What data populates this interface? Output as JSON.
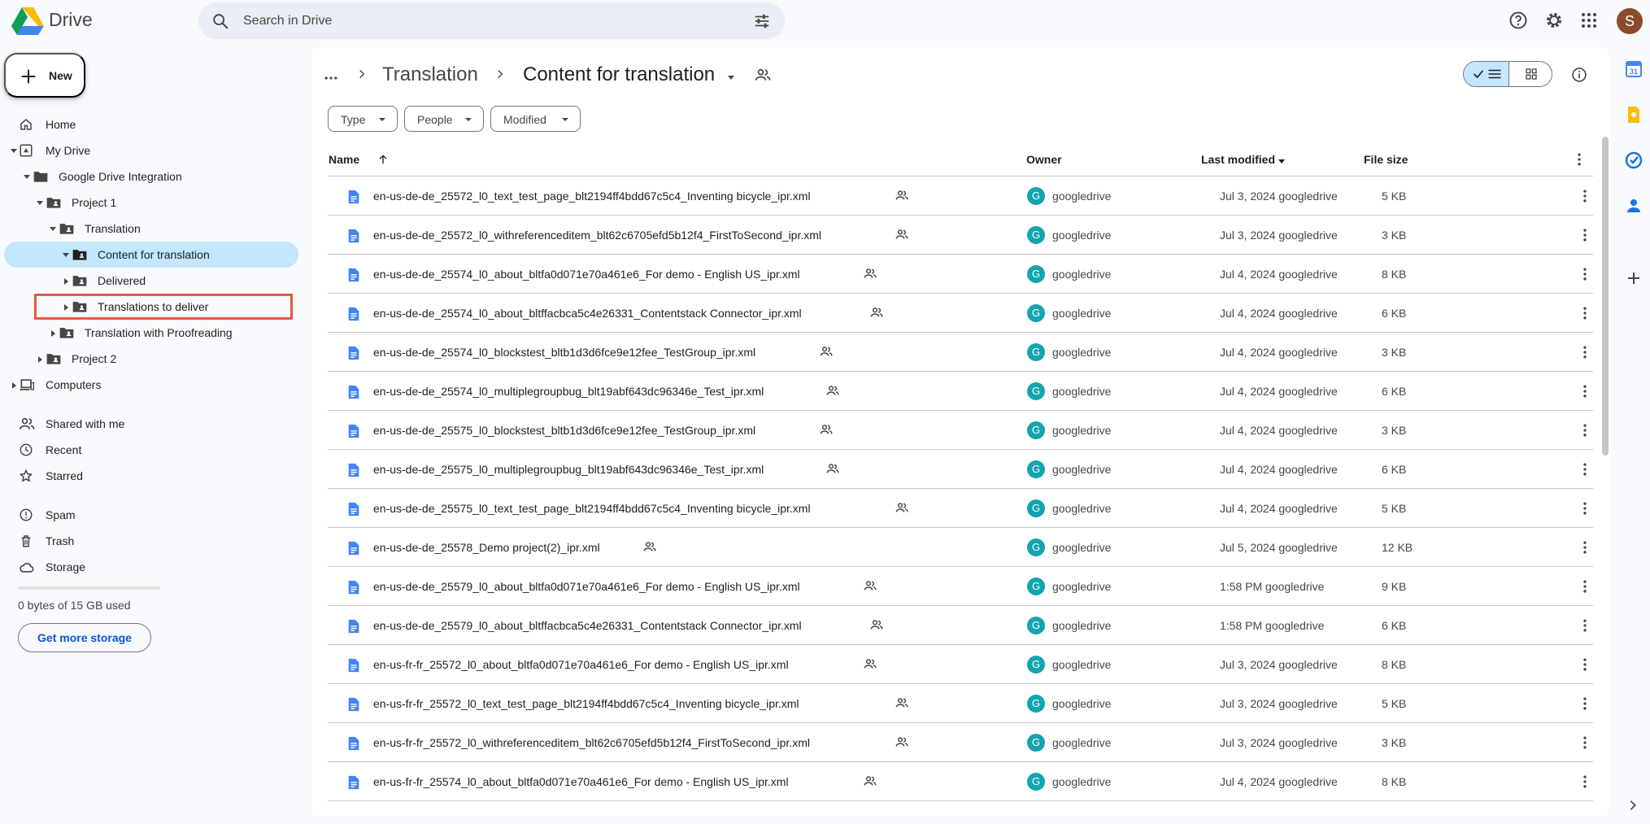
{
  "app": {
    "brand": "Drive",
    "search_placeholder": "Search in Drive",
    "avatar_letter": "S"
  },
  "sidebar": {
    "new_label": "New",
    "items": [
      {
        "label": "Home",
        "icon": "home-icon"
      },
      {
        "label": "My Drive",
        "icon": "my-drive-icon"
      },
      {
        "label": "Google Drive Integration",
        "icon": "folder-icon"
      },
      {
        "label": "Project 1",
        "icon": "shared-folder-icon"
      },
      {
        "label": "Translation",
        "icon": "shared-folder-icon"
      },
      {
        "label": "Content for translation",
        "icon": "shared-folder-icon"
      },
      {
        "label": "Delivered",
        "icon": "shared-folder-icon"
      },
      {
        "label": "Translations to deliver",
        "icon": "shared-folder-icon"
      },
      {
        "label": "Translation with Proofreading",
        "icon": "shared-folder-icon"
      },
      {
        "label": "Project 2",
        "icon": "shared-folder-icon"
      },
      {
        "label": "Computers",
        "icon": "computers-icon"
      },
      {
        "label": "Shared with me",
        "icon": "people-icon"
      },
      {
        "label": "Recent",
        "icon": "clock-icon"
      },
      {
        "label": "Starred",
        "icon": "star-icon"
      },
      {
        "label": "Spam",
        "icon": "spam-icon"
      },
      {
        "label": "Trash",
        "icon": "trash-icon"
      },
      {
        "label": "Storage",
        "icon": "cloud-icon"
      }
    ],
    "storage_used": "0 bytes of 15 GB used",
    "storage_fraction": 0,
    "get_storage": "Get more storage"
  },
  "breadcrumb": {
    "parent": "Translation",
    "current": "Content for translation"
  },
  "filters": {
    "type": "Type",
    "people": "People",
    "modified": "Modified"
  },
  "table": {
    "headers": {
      "name": "Name",
      "owner": "Owner",
      "modified": "Last modified",
      "size": "File size"
    },
    "rows": [
      {
        "name": "en-us-de-de_25572_l0_text_test_page_blt2194ff4bdd67c5c4_Inventing bicycle_ipr.xml",
        "owner": "googledrive",
        "modified": "Jul 3, 2024 googledrive",
        "size": "5 KB"
      },
      {
        "name": "en-us-de-de_25572_l0_withreferenceditem_blt62c6705efd5b12f4_FirstToSecond_ipr.xml",
        "owner": "googledrive",
        "modified": "Jul 3, 2024 googledrive",
        "size": "3 KB"
      },
      {
        "name": "en-us-de-de_25574_l0_about_bltfa0d071e70a461e6_For demo - English US_ipr.xml",
        "owner": "googledrive",
        "modified": "Jul 4, 2024 googledrive",
        "size": "8 KB"
      },
      {
        "name": "en-us-de-de_25574_l0_about_bltffacbca5c4e26331_Contentstack Connector_ipr.xml",
        "owner": "googledrive",
        "modified": "Jul 4, 2024 googledrive",
        "size": "6 KB"
      },
      {
        "name": "en-us-de-de_25574_l0_blockstest_bltb1d3d6fce9e12fee_TestGroup_ipr.xml",
        "owner": "googledrive",
        "modified": "Jul 4, 2024 googledrive",
        "size": "3 KB"
      },
      {
        "name": "en-us-de-de_25574_l0_multiplegroupbug_blt19abf643dc96346e_Test_ipr.xml",
        "owner": "googledrive",
        "modified": "Jul 4, 2024 googledrive",
        "size": "6 KB"
      },
      {
        "name": "en-us-de-de_25575_l0_blockstest_bltb1d3d6fce9e12fee_TestGroup_ipr.xml",
        "owner": "googledrive",
        "modified": "Jul 4, 2024 googledrive",
        "size": "3 KB"
      },
      {
        "name": "en-us-de-de_25575_l0_multiplegroupbug_blt19abf643dc96346e_Test_ipr.xml",
        "owner": "googledrive",
        "modified": "Jul 4, 2024 googledrive",
        "size": "6 KB"
      },
      {
        "name": "en-us-de-de_25575_l0_text_test_page_blt2194ff4bdd67c5c4_Inventing bicycle_ipr.xml",
        "owner": "googledrive",
        "modified": "Jul 4, 2024 googledrive",
        "size": "5 KB"
      },
      {
        "name": "en-us-de-de_25578_Demo project(2)_ipr.xml",
        "owner": "googledrive",
        "modified": "Jul 5, 2024 googledrive",
        "size": "12 KB"
      },
      {
        "name": "en-us-de-de_25579_l0_about_bltfa0d071e70a461e6_For demo - English US_ipr.xml",
        "owner": "googledrive",
        "modified": "1:58 PM googledrive",
        "size": "9 KB"
      },
      {
        "name": "en-us-de-de_25579_l0_about_bltffacbca5c4e26331_Contentstack Connector_ipr.xml",
        "owner": "googledrive",
        "modified": "1:58 PM googledrive",
        "size": "6 KB"
      },
      {
        "name": "en-us-fr-fr_25572_l0_about_bltfa0d071e70a461e6_For demo - English US_ipr.xml",
        "owner": "googledrive",
        "modified": "Jul 3, 2024 googledrive",
        "size": "8 KB"
      },
      {
        "name": "en-us-fr-fr_25572_l0_text_test_page_blt2194ff4bdd67c5c4_Inventing bicycle_ipr.xml",
        "owner": "googledrive",
        "modified": "Jul 3, 2024 googledrive",
        "size": "5 KB"
      },
      {
        "name": "en-us-fr-fr_25572_l0_withreferenceditem_blt62c6705efd5b12f4_FirstToSecond_ipr.xml",
        "owner": "googledrive",
        "modified": "Jul 3, 2024 googledrive",
        "size": "3 KB"
      },
      {
        "name": "en-us-fr-fr_25574_l0_about_bltfa0d071e70a461e6_For demo - English US_ipr.xml",
        "owner": "googledrive",
        "modified": "Jul 4, 2024 googledrive",
        "size": "8 KB"
      }
    ]
  },
  "colors": {
    "accent": "#0b57d0",
    "selected": "#c2e7ff",
    "highlight_box": "#e25a43",
    "owner_avatar": "#12a4af"
  }
}
